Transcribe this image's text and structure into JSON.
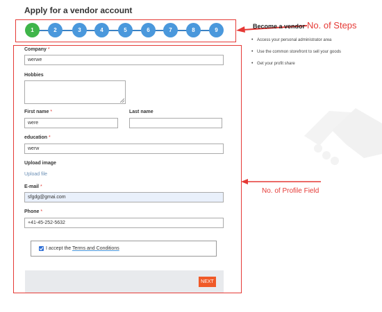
{
  "page_title": "Apply for a vendor account",
  "steps": [
    "1",
    "2",
    "3",
    "4",
    "5",
    "6",
    "7",
    "8",
    "9"
  ],
  "active_step": "1",
  "form": {
    "company": {
      "label": "Company",
      "value": "werwe",
      "required": "*"
    },
    "hobbies": {
      "label": "Hobbies",
      "value": ""
    },
    "first_name": {
      "label": "First name",
      "value": "were",
      "required": "*"
    },
    "last_name": {
      "label": "Last name",
      "value": ""
    },
    "education": {
      "label": "education",
      "value": "werw",
      "required": "*"
    },
    "upload_image": {
      "label": "Upload image",
      "link": "Upload file"
    },
    "email": {
      "label": "E-mail",
      "value": "sfgdg@gmai.com",
      "required": "*"
    },
    "phone": {
      "label": "Phone",
      "value": "+41-45-252-5632",
      "required": "*"
    },
    "terms": {
      "prefix": "I accept the ",
      "link": "Terms and Conditions",
      "checked": true
    },
    "next_label": "NEXT"
  },
  "sidebar": {
    "heading": "Become a vendor",
    "bullets": [
      "Access your personal administrator area",
      "Use the common storefront to sell your goods",
      "Get your profit share"
    ]
  },
  "annotations": {
    "steps_callout": "No. of Steps",
    "fields_callout": "No. of Profile Field"
  },
  "colors": {
    "accent": "#e53935",
    "step": "#4a98dc",
    "step_active": "#3fb54a",
    "button": "#f05a28"
  }
}
